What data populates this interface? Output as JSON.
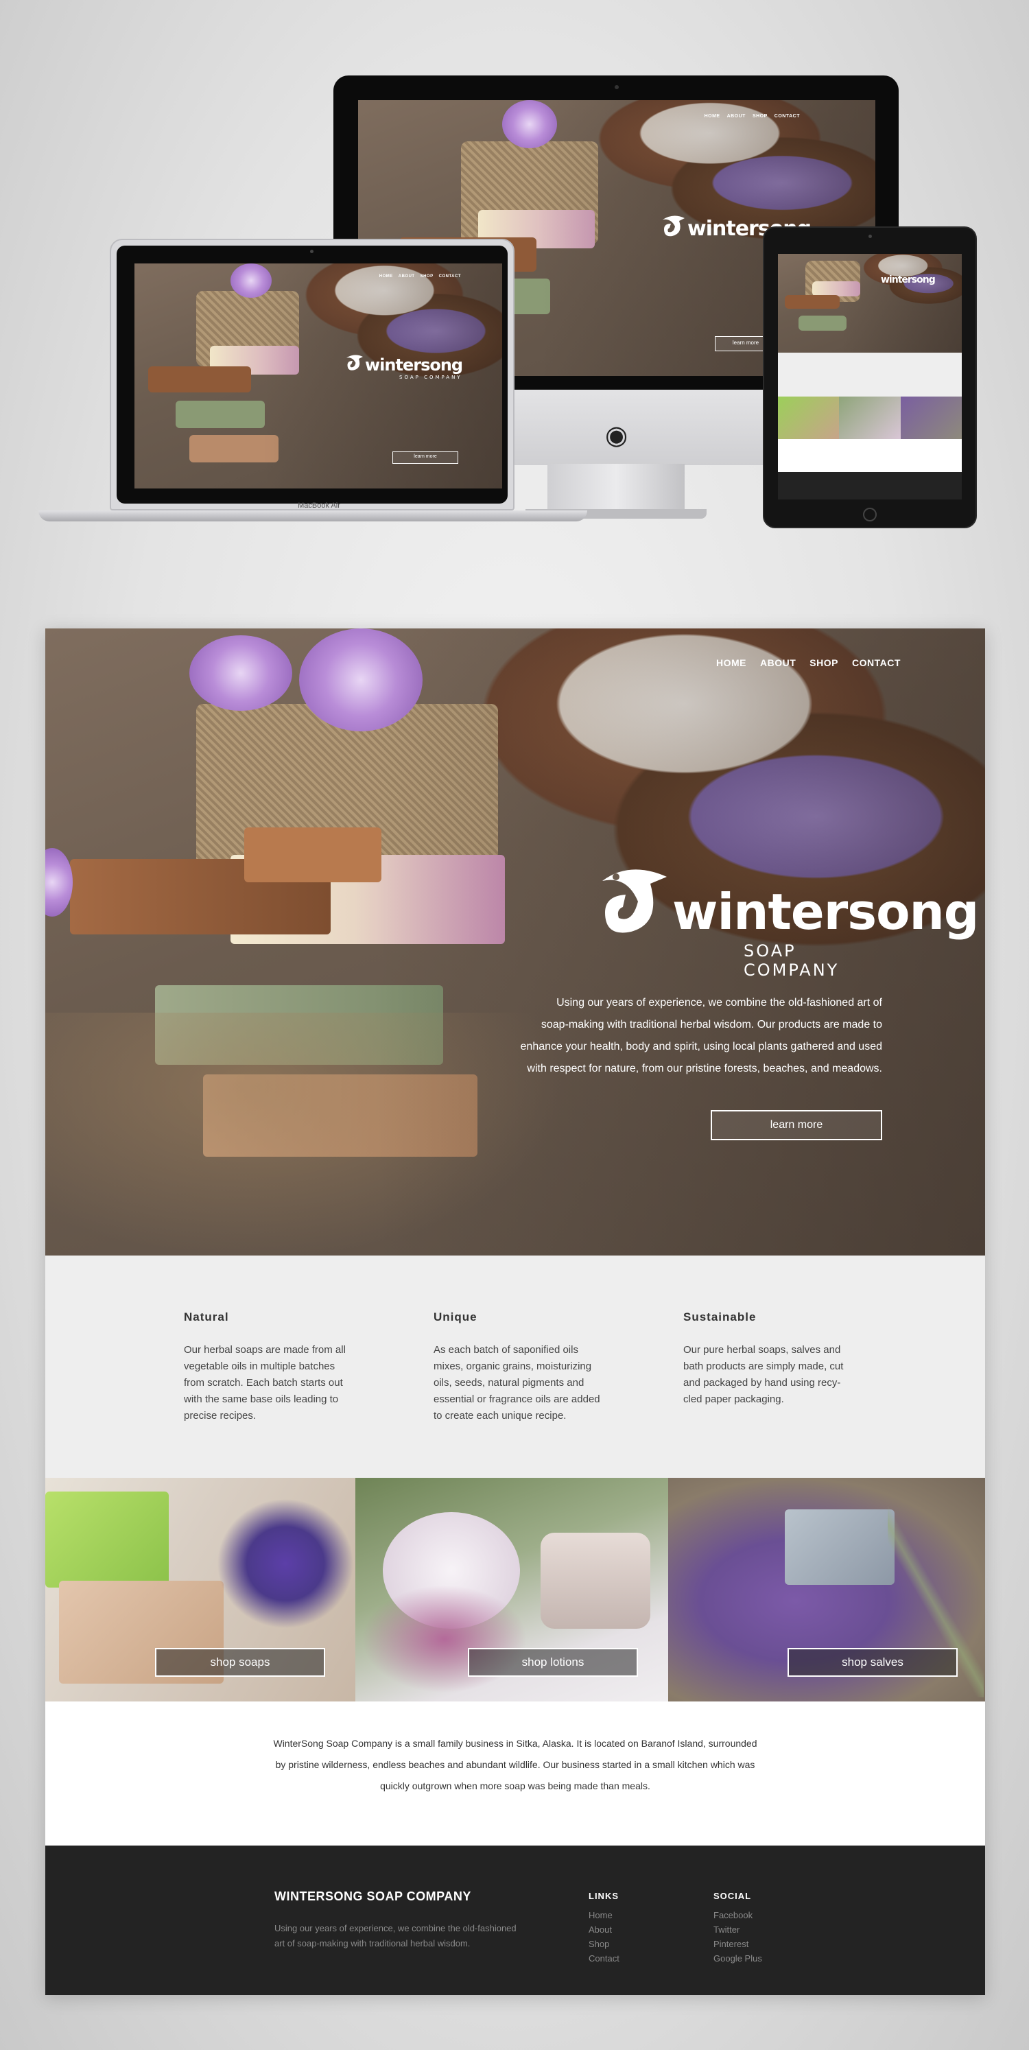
{
  "site": {
    "nav": [
      "HOME",
      "ABOUT",
      "SHOP",
      "CONTACT"
    ],
    "brand": {
      "name": "wintersong",
      "tagline": "SOAP COMPANY"
    },
    "hero_text": "Using our years of experience, we combine the old-fashioned art of soap-making with traditional herbal wisdom. Our products are made to enhance your health, body and spirit, using local plants gathered and used with respect for nature, from our pristine forests, beaches, and meadows.",
    "hero_lines": [
      "Using our years of experience, we combine the old-fashioned art of",
      "soap-making with traditional herbal wisdom. Our products are made to",
      "enhance your health, body and spirit, using local plants gathered and used",
      "with respect for nature, from our pristine forests, beaches, and meadows."
    ],
    "learn_more": "learn more",
    "features": [
      {
        "title": "Natural",
        "text": "Our herbal soaps are made from all vegetable oils in multiple batches from scratch. Each batch starts out with the same base oils leading to precise recipes."
      },
      {
        "title": "Unique",
        "text": "As each batch of saponified oils mixes, organic grains, moisturizing oils, seeds, natural pigments and essential or fragrance oils are added to create each unique recipe."
      },
      {
        "title": "Sustainable",
        "text": "Our pure herbal soaps, salves and bath products are simply made, cut and packaged by hand using recy-cled paper packaging."
      }
    ],
    "shop": [
      {
        "label": "shop soaps"
      },
      {
        "label": "shop lotions"
      },
      {
        "label": "shop salves"
      }
    ],
    "about_text": "WinterSong Soap Company is a small family business in Sitka, Alaska. It is located on Baranof Island, surrounded by pristine wilderness, endless beaches and abundant wildlife. Our business started in a  small kitchen which was quickly outgrown when more soap was being made than meals.",
    "footer": {
      "title": "WINTERSONG SOAP COMPANY",
      "text": "Using our years of experience, we combine the old-fashioned art of soap-making with traditional herbal wisdom.",
      "links_title": "LINKS",
      "links": [
        "Home",
        "About",
        "Shop",
        "Contact"
      ],
      "social_title": "SOCIAL",
      "social": [
        "Facebook",
        "Twitter",
        "Pinterest",
        "Google Plus"
      ]
    }
  },
  "devices": {
    "laptop_label": "MacBook Air"
  },
  "colors": {
    "footer_bg": "#232323",
    "section_bg": "#eeeeee",
    "accent_lavender": "#9d86c8"
  }
}
